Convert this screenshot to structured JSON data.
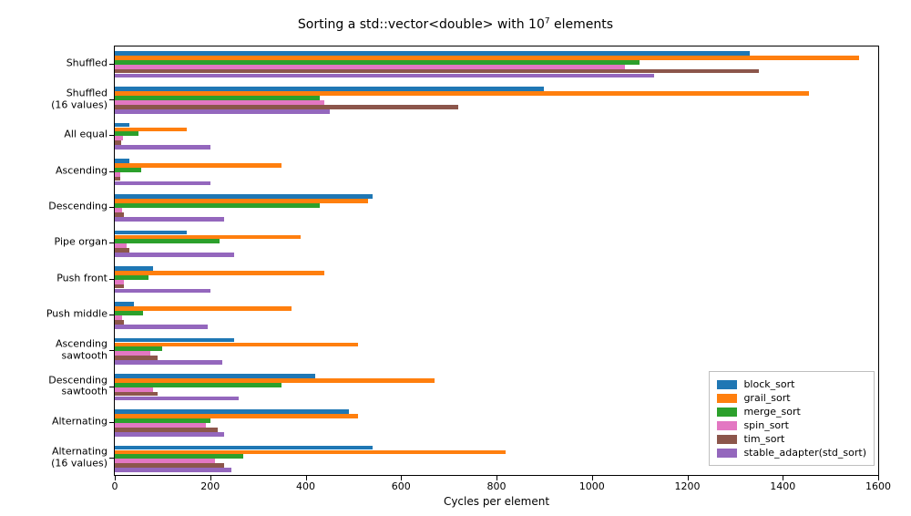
{
  "chart_data": {
    "type": "bar",
    "orientation": "horizontal",
    "title_html": "Sorting a std::vector&lt;double&gt; with 10<sup>7</sup> elements",
    "xlabel": "Cycles per element",
    "ylabel": "",
    "xlim": [
      0,
      1600
    ],
    "categories": [
      "Shuffled",
      "Shuffled\n(16 values)",
      "All equal",
      "Ascending",
      "Descending",
      "Pipe organ",
      "Push front",
      "Push middle",
      "Ascending\nsawtooth",
      "Descending\nsawtooth",
      "Alternating",
      "Alternating\n(16 values)"
    ],
    "series": [
      {
        "name": "block_sort",
        "color": "#1f77b4",
        "values": [
          1330,
          900,
          30,
          30,
          540,
          150,
          80,
          40,
          250,
          420,
          490,
          540
        ]
      },
      {
        "name": "grail_sort",
        "color": "#ff7f0e",
        "values": [
          1560,
          1455,
          150,
          350,
          530,
          390,
          440,
          370,
          510,
          670,
          510,
          820
        ]
      },
      {
        "name": "merge_sort",
        "color": "#2ca02c",
        "values": [
          1100,
          430,
          50,
          55,
          430,
          220,
          70,
          60,
          100,
          350,
          200,
          270
        ]
      },
      {
        "name": "spin_sort",
        "color": "#e377c2",
        "values": [
          1070,
          440,
          18,
          12,
          15,
          25,
          20,
          15,
          75,
          80,
          190,
          210
        ]
      },
      {
        "name": "tim_sort",
        "color": "#8c564b",
        "values": [
          1350,
          720,
          14,
          12,
          20,
          30,
          20,
          20,
          90,
          90,
          215,
          230
        ]
      },
      {
        "name": "stable_adapter(std_sort)",
        "color": "#9467bd",
        "values": [
          1130,
          450,
          200,
          200,
          230,
          250,
          200,
          195,
          225,
          260,
          230,
          245
        ]
      }
    ],
    "xticks": [
      0,
      200,
      400,
      600,
      800,
      1000,
      1200,
      1400,
      1600
    ],
    "legend_position": "lower-right"
  }
}
